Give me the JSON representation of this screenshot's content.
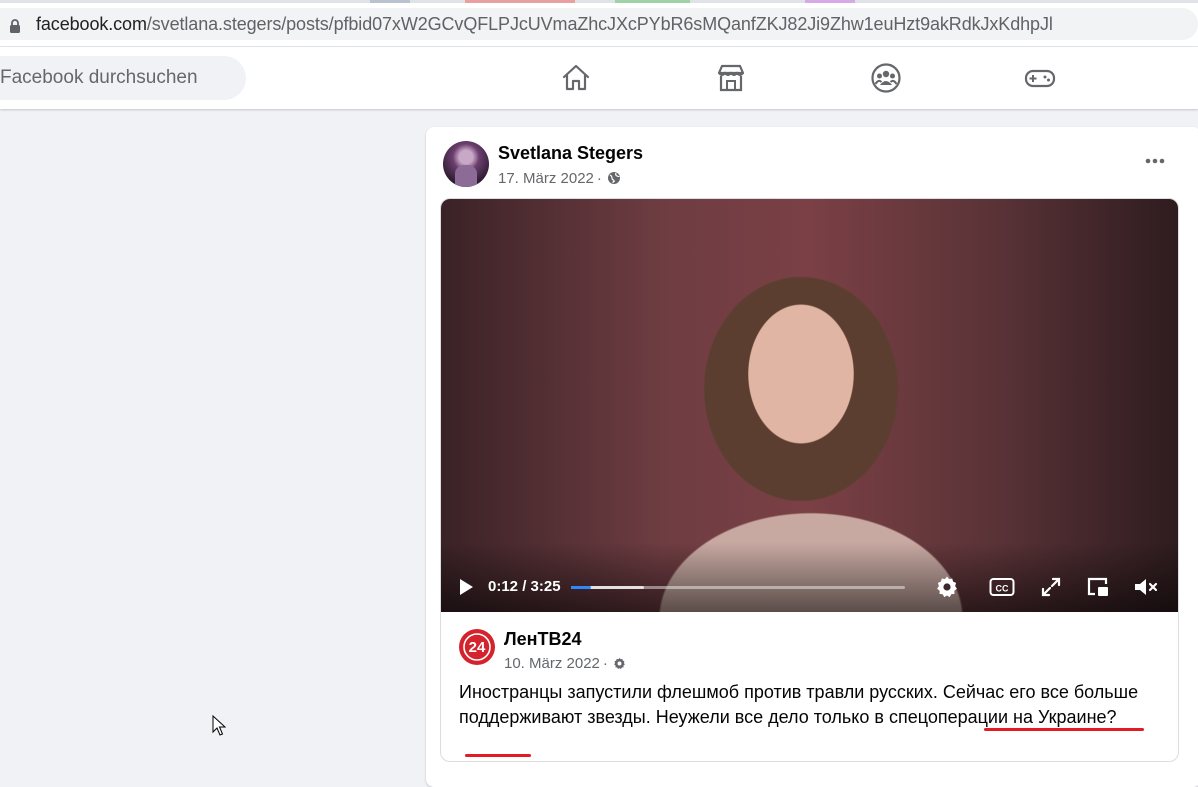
{
  "browser": {
    "url_domain": "facebook.com",
    "url_path": "/svetlana.stegers/posts/pfbid07xW2GCvQFLPJcUVmaZhcJXcPYbR6sMQanfZKJ82Ji9Zhw1euHzt9akRdkJxKdhpJl"
  },
  "nav": {
    "search_placeholder": "Facebook durchsuchen",
    "icons": [
      "home-icon",
      "marketplace-icon",
      "groups-icon",
      "gaming-icon"
    ]
  },
  "post": {
    "author": "Svetlana Stegers",
    "date": "17. März 2022",
    "separator": "·",
    "privacy_icon": "globe-icon",
    "shared": {
      "video": {
        "current_time": "0:12",
        "duration": "3:25",
        "time_separator": " / ",
        "progress_fraction": 0.06,
        "buffered_fraction": 0.22,
        "controls": [
          "play-icon",
          "settings-icon",
          "captions-icon",
          "fullscreen-icon",
          "pip-icon",
          "mute-icon"
        ]
      },
      "source_name": "ЛенТВ24",
      "source_date": "10. März 2022",
      "source_logo_text": "24",
      "text_part1": "Иностранцы запустили флешмоб против травли русских. Сейчас его все больше поддерживают звезды. Неужели все дело только в ",
      "text_highlight1": "спецоперации на",
      "text_space": " ",
      "text_highlight2": "Украине",
      "text_end": "?"
    }
  },
  "colors": {
    "accent": "#2d88ff",
    "annotation": "#e31b23",
    "page_bg": "#f0f2f5"
  }
}
